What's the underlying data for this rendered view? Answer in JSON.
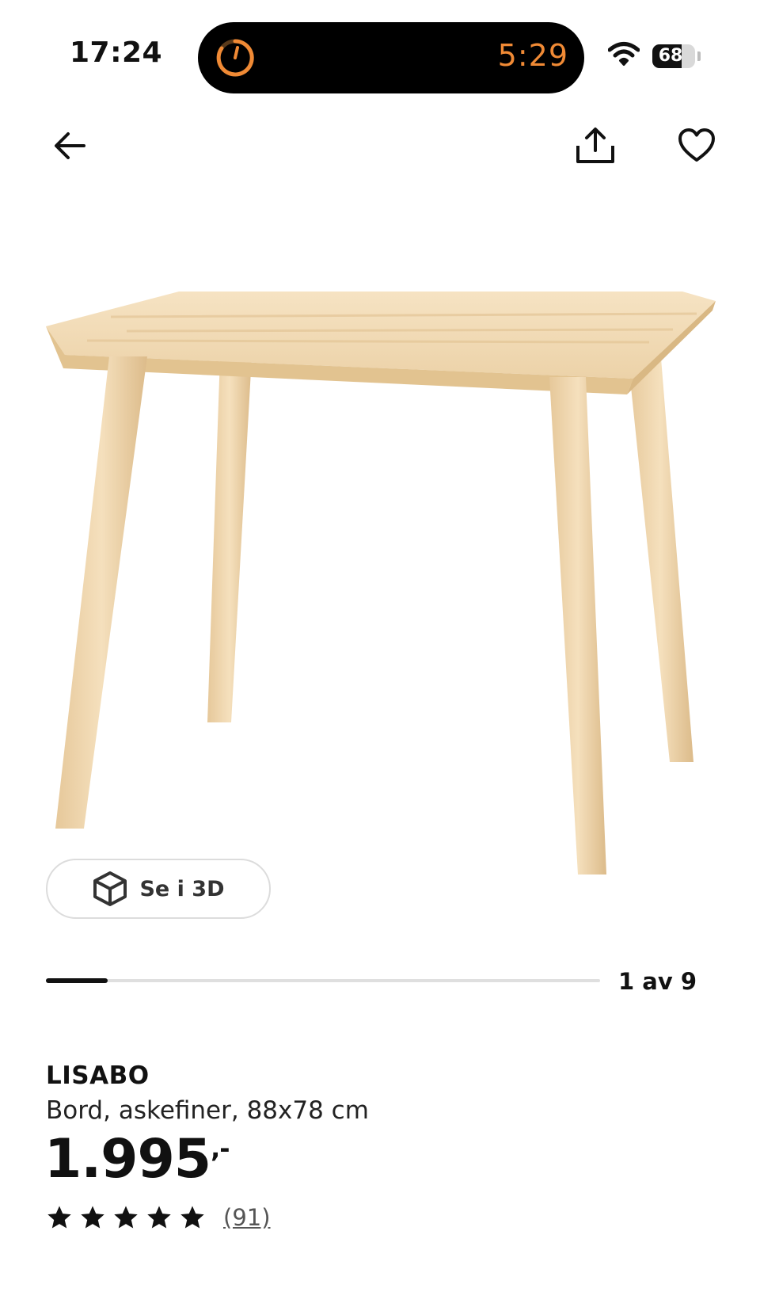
{
  "status_bar": {
    "time": "17:24",
    "live_activity_timer": "5:29",
    "battery_level": "68",
    "battery_fraction": 0.68
  },
  "nav": {
    "back_icon": "arrow-left-icon",
    "share_icon": "share-icon",
    "favorite_icon": "heart-outline-icon"
  },
  "gallery": {
    "view_3d_label": "Se i 3D",
    "view_3d_icon": "cube-icon",
    "counter": "1 av 9",
    "current": 1,
    "total": 9
  },
  "product": {
    "name": "LISABO",
    "description": "Bord, askefiner, 88x78 cm",
    "price": "1.995",
    "price_suffix": ",-",
    "rating_stars": 5,
    "review_count": "(91)"
  },
  "colors": {
    "timer_orange": "#f08a35",
    "wood": "#efd6ad",
    "text": "#111111"
  }
}
